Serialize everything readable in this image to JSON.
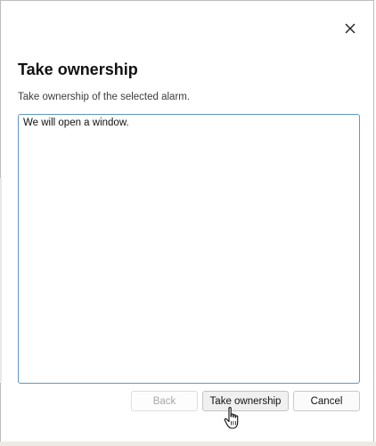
{
  "dialog": {
    "title": "Take ownership",
    "subtitle": "Take ownership of the selected alarm.",
    "comment_value": "We will open a window.",
    "close_icon": "close-icon"
  },
  "buttons": {
    "back_label": "Back",
    "back_enabled": false,
    "take_ownership_label": "Take ownership",
    "cancel_label": "Cancel"
  },
  "colors": {
    "focus_border": "#5e97c8",
    "disabled_text": "#a8a8a8"
  },
  "pointer": {
    "icon": "hand-pointer-icon"
  }
}
